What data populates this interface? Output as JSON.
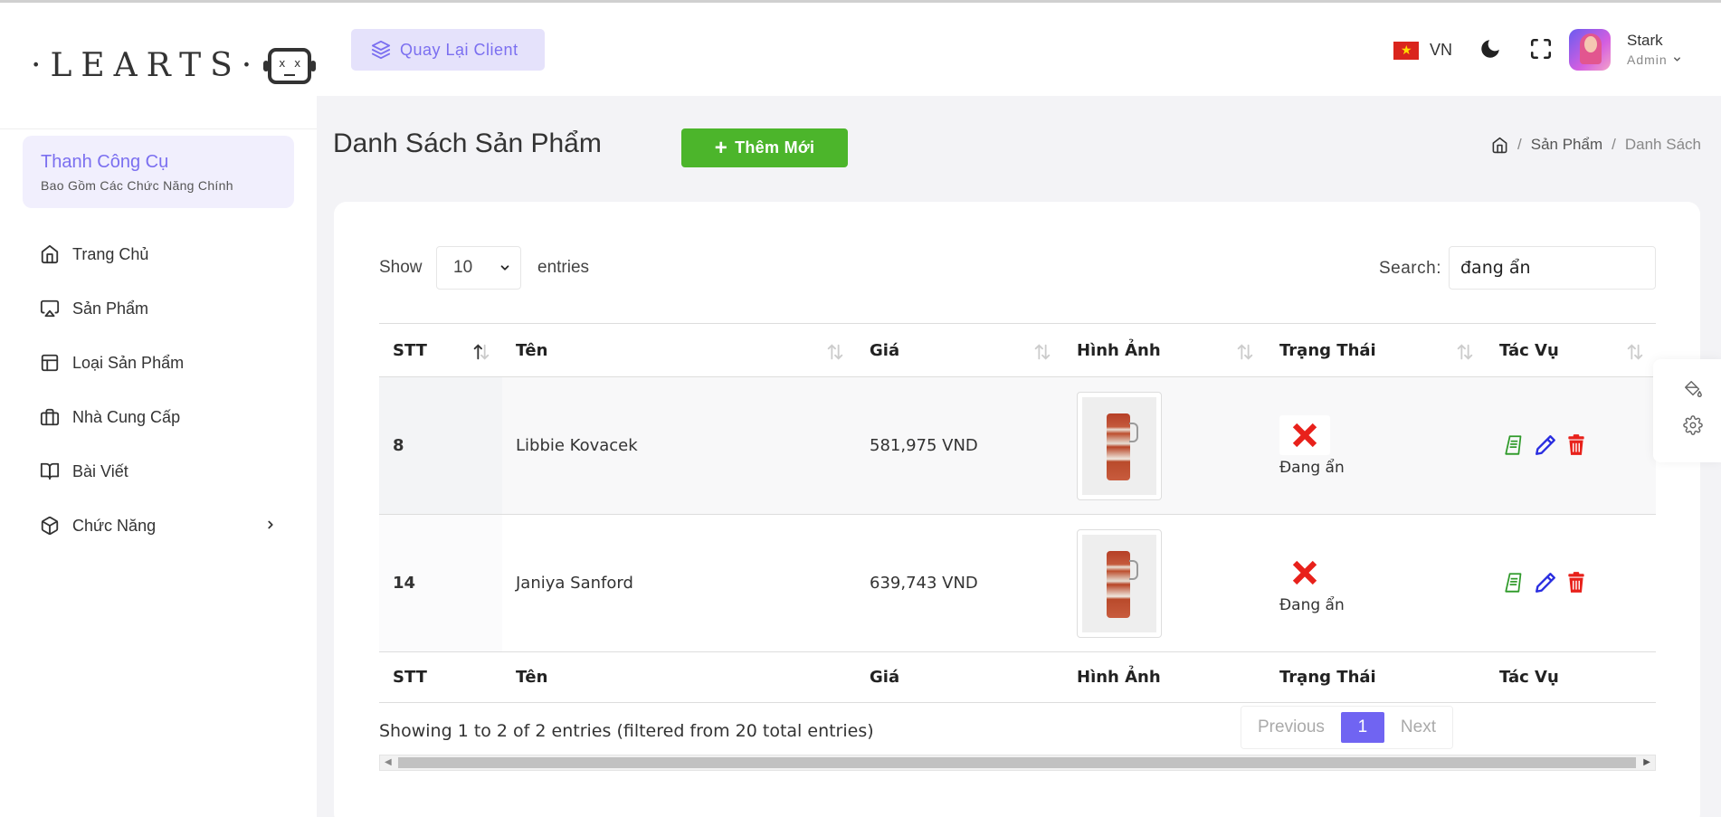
{
  "brand": {
    "logo_text": "·LEARTS·"
  },
  "sidebar": {
    "tool_title": "Thanh Công Cụ",
    "tool_subtitle": "Bao Gồm Các Chức Năng Chính",
    "items": [
      {
        "label": "Trang Chủ",
        "icon": "home-icon"
      },
      {
        "label": "Sản Phẩm",
        "icon": "airplay-icon"
      },
      {
        "label": "Loại Sản Phẩm",
        "icon": "layout-icon"
      },
      {
        "label": "Nhà Cung Cấp",
        "icon": "briefcase-icon"
      },
      {
        "label": "Bài Viết",
        "icon": "book-open-icon"
      },
      {
        "label": "Chức Năng",
        "icon": "box-icon"
      }
    ]
  },
  "header": {
    "back_label": "Quay Lại Client",
    "language": "VN",
    "user_name": "Stark",
    "user_role": "Admin"
  },
  "page": {
    "title": "Danh Sách Sản Phẩm",
    "add_label": "Thêm Mới",
    "breadcrumb": [
      "Sản Phẩm",
      "Danh Sách"
    ]
  },
  "table_controls": {
    "show_label": "Show",
    "page_size": "10",
    "entries_label": "entries",
    "search_label": "Search:",
    "search_value": "đang ẩn"
  },
  "table": {
    "columns": [
      "STT",
      "Tên",
      "Giá",
      "Hình Ảnh",
      "Trạng Thái",
      "Tác Vụ"
    ],
    "rows": [
      {
        "stt": "8",
        "name": "Libbie Kovacek",
        "price": "581,975 VND",
        "status": "Đang ẩn"
      },
      {
        "stt": "14",
        "name": "Janiya Sanford",
        "price": "639,743 VND",
        "status": "Đang ẩn"
      }
    ]
  },
  "footer": {
    "info": "Showing 1 to 2 of 2 entries (filtered from 20 total entries)",
    "prev_label": "Previous",
    "current_page": "1",
    "next_label": "Next"
  },
  "colors": {
    "accent": "#7064f2",
    "add_button": "#4cb52b",
    "delete": "#e8211b",
    "edit": "#2a2ee0",
    "detail": "#2f9a2a"
  }
}
